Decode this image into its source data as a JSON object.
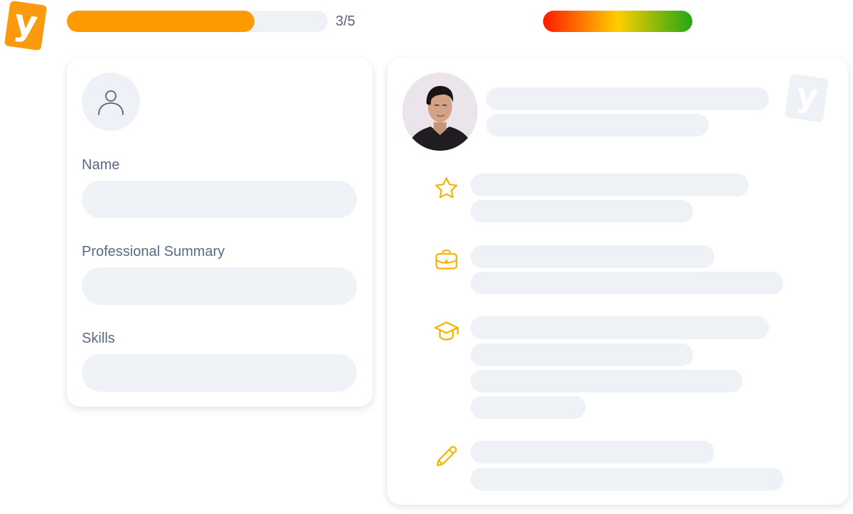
{
  "brand": {
    "logo_letter": "y",
    "accent": "#fd9a00"
  },
  "progress": {
    "text": "3/5",
    "current": 3,
    "total": 5,
    "fill_fraction": 0.72
  },
  "score_meter": {
    "gradient": [
      "#ff1a00",
      "#ffce00",
      "#22a614"
    ]
  },
  "form": {
    "avatar_icon": "user-icon",
    "fields": [
      {
        "label": "Name",
        "value": ""
      },
      {
        "label": "Professional Summary",
        "value": ""
      },
      {
        "label": "Skills",
        "value": ""
      }
    ]
  },
  "preview": {
    "watermark_letter": "y",
    "sections": [
      {
        "icon": "star-icon"
      },
      {
        "icon": "briefcase-icon"
      },
      {
        "icon": "graduation-cap-icon"
      },
      {
        "icon": "pencil-icon"
      }
    ],
    "icon_color": "#f6b400"
  }
}
